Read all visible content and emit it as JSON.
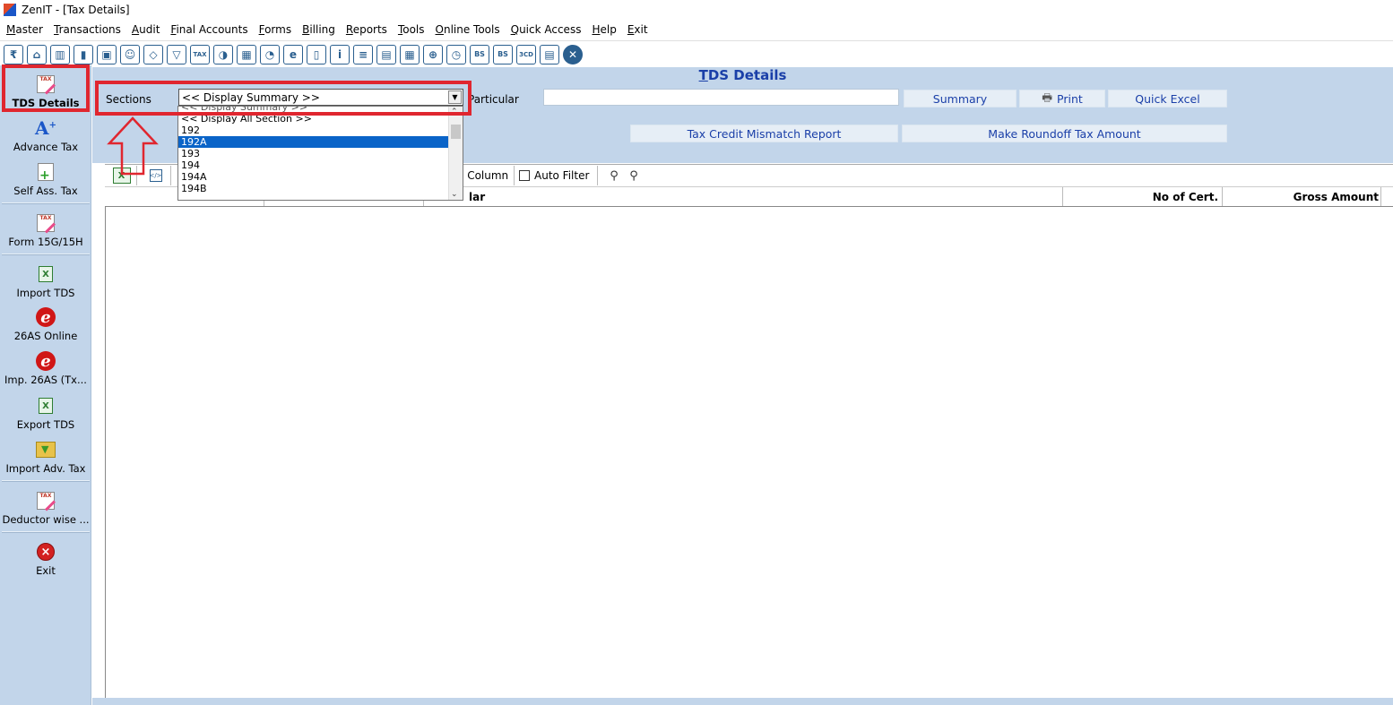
{
  "window": {
    "title": "ZenIT - [Tax Details]"
  },
  "menu": [
    "Master",
    "Transactions",
    "Audit",
    "Final Accounts",
    "Forms",
    "Billing",
    "Reports",
    "Tools",
    "Online Tools",
    "Quick Access",
    "Help",
    "Exit"
  ],
  "toolbar_icons": [
    "rupee-icon",
    "home-icon",
    "building-icon",
    "chart-icon",
    "gift-icon",
    "users-icon",
    "pin-icon",
    "filter-icon",
    "tax-icon",
    "refresh-icon",
    "calculator-icon",
    "pie-icon",
    "epay-icon",
    "book-icon",
    "info-icon",
    "report-icon",
    "profile-icon",
    "calendar-icon",
    "add-page-icon",
    "clock-icon",
    "bs-icon",
    "bs-sch-icon",
    "3cd-icon",
    "form-icon",
    "close-icon"
  ],
  "toolbar_icon_labels": {
    "tax": "TAX",
    "epay": "e",
    "bs": "BS",
    "bs_sch": "BS",
    "threecd": "3CD",
    "close": "✕"
  },
  "sidebar": {
    "items": [
      {
        "label": "TDS Details"
      },
      {
        "label": "Advance Tax"
      },
      {
        "label": "Self Ass. Tax"
      },
      {
        "label": "Form 15G/15H"
      },
      {
        "label": "Import TDS"
      },
      {
        "label": "26AS Online"
      },
      {
        "label": "Imp. 26AS (Tx..."
      },
      {
        "label": "Export TDS"
      },
      {
        "label": "Import Adv. Tax"
      },
      {
        "label": "Deductor wise ..."
      },
      {
        "label": "Exit"
      }
    ]
  },
  "main": {
    "title": "TDS Details",
    "sections_label": "Sections",
    "particular_label": "Particular",
    "particular_value": "",
    "sections_selected": "<< Display Summary >>",
    "sections_options": [
      "<< Display Summary >>",
      "<< Display All Section >>",
      "192",
      "192A",
      "193",
      "194",
      "194A",
      "194B"
    ],
    "sections_highlighted": "192A",
    "buttons": {
      "summary": "Summary",
      "print": "Print",
      "quick_excel": "Quick Excel",
      "mismatch": "Tax Credit Mismatch Report",
      "roundoff": "Make Roundoff Tax Amount"
    },
    "grid_toolbar": {
      "column_label": "e Column",
      "auto_filter": "Auto Filter"
    },
    "grid_columns": [
      "",
      "",
      "lar",
      "No of Cert.",
      "Gross Amount"
    ]
  },
  "colors": {
    "panel": "#c2d5ea",
    "title": "#1a3fa8",
    "highlight": "#e0262f",
    "selection": "#0a64c8"
  }
}
